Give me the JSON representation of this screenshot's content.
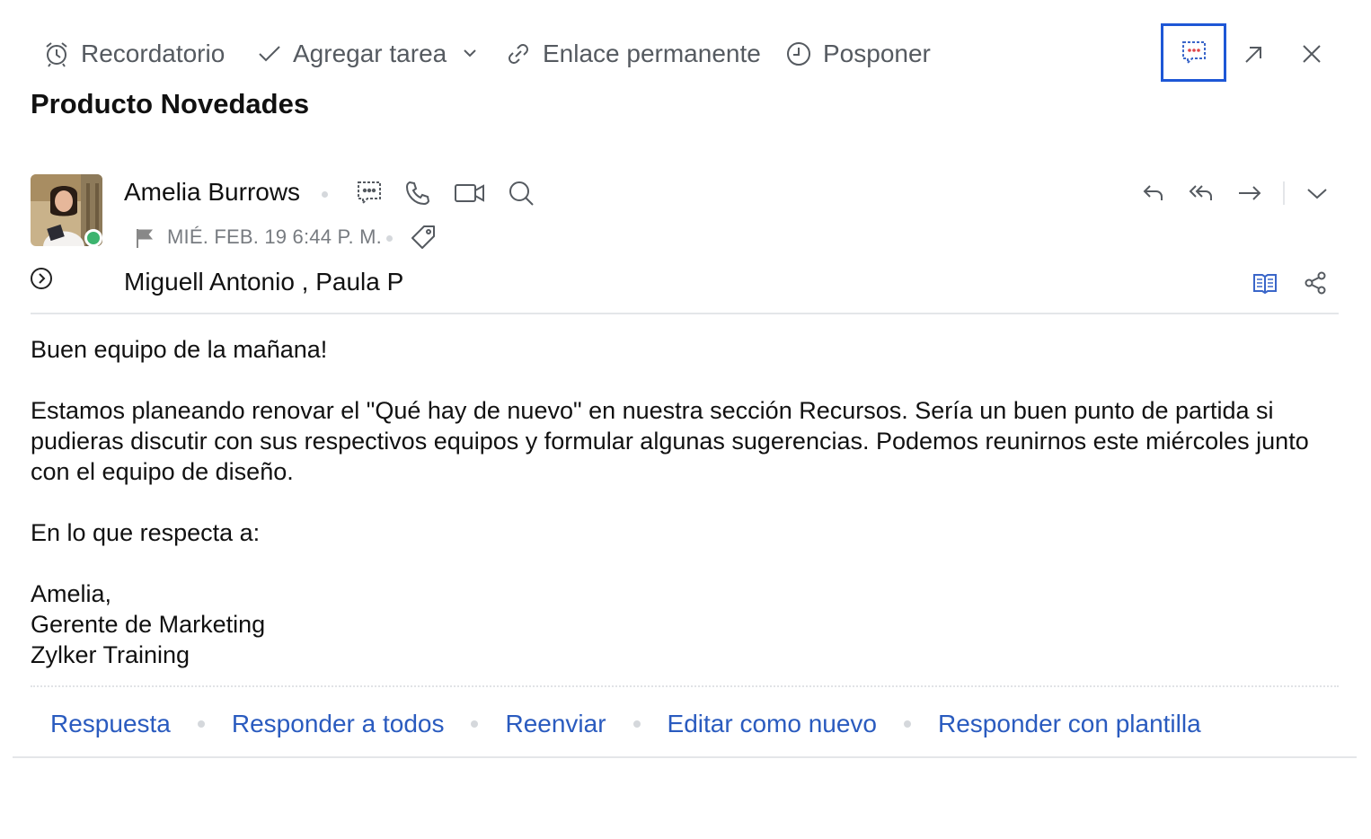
{
  "toolbar": {
    "reminder_label": "Recordatorio",
    "add_task_label": "Agregar tarea",
    "permalink_label": "Enlace permanente",
    "snooze_label": "Posponer"
  },
  "email": {
    "subject": "Producto Novedades",
    "sender_name": "Amelia Burrows",
    "date": "MIÉ. FEB. 19 6:44 P. M.",
    "recipients": "Miguell Antonio , Paula P",
    "body": {
      "greeting": "Buen equipo de la mañana!",
      "paragraph": "Estamos planeando renovar el \"Qué hay de nuevo\" en nuestra sección Recursos. Sería un buen punto de partida si pudieras discutir con sus respectivos equipos y formular algunas sugerencias. Podemos reunirnos este miércoles junto con el equipo de diseño.",
      "regards": "En lo que respecta a:",
      "signature_name": "Amelia,",
      "signature_title": "Gerente de Marketing",
      "signature_company": "Zylker Training"
    }
  },
  "actions": {
    "reply": "Respuesta",
    "reply_all": "Responder a todos",
    "forward": "Reenviar",
    "edit_as_new": "Editar como nuevo",
    "reply_template": "Responder con plantilla"
  },
  "colors": {
    "accent": "#1e57d6",
    "link": "#2a5bbf",
    "online": "#3cb46e"
  }
}
